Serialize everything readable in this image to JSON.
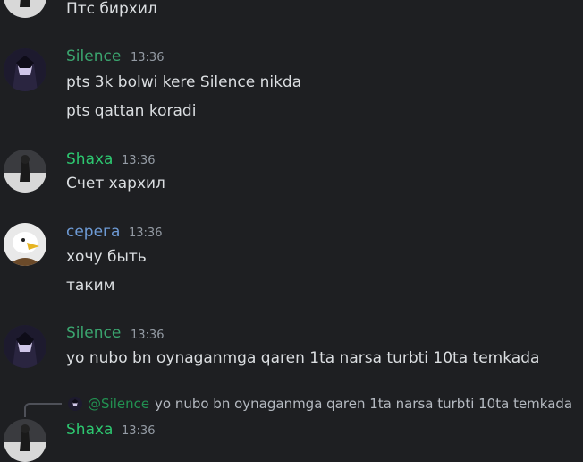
{
  "colors": {
    "silence": "#3ba56f",
    "shaxa": "#2dc770",
    "serega": "#6e9bd6"
  },
  "top": {
    "message": "Птс бирхил"
  },
  "groups": [
    {
      "user": "Silence",
      "time": "13:36",
      "messages": [
        "pts 3k bolwi kere Silence nikda",
        "pts qattan koradi"
      ]
    },
    {
      "user": "Shaxa",
      "time": "13:36",
      "messages": [
        "Счет хархил"
      ]
    },
    {
      "user": "серега",
      "time": "13:36",
      "messages": [
        "хочу быть",
        "таким"
      ]
    },
    {
      "user": "Silence",
      "time": "13:36",
      "messages": [
        "yo nubo bn oynaganmga qaren 1ta narsa turbti 10ta temkada"
      ]
    }
  ],
  "reply": {
    "mention": "@Silence",
    "text": "yo nubo bn oynaganmga qaren 1ta narsa turbti 10ta temkada"
  },
  "last": {
    "user": "Shaxa",
    "time": "13:36"
  }
}
